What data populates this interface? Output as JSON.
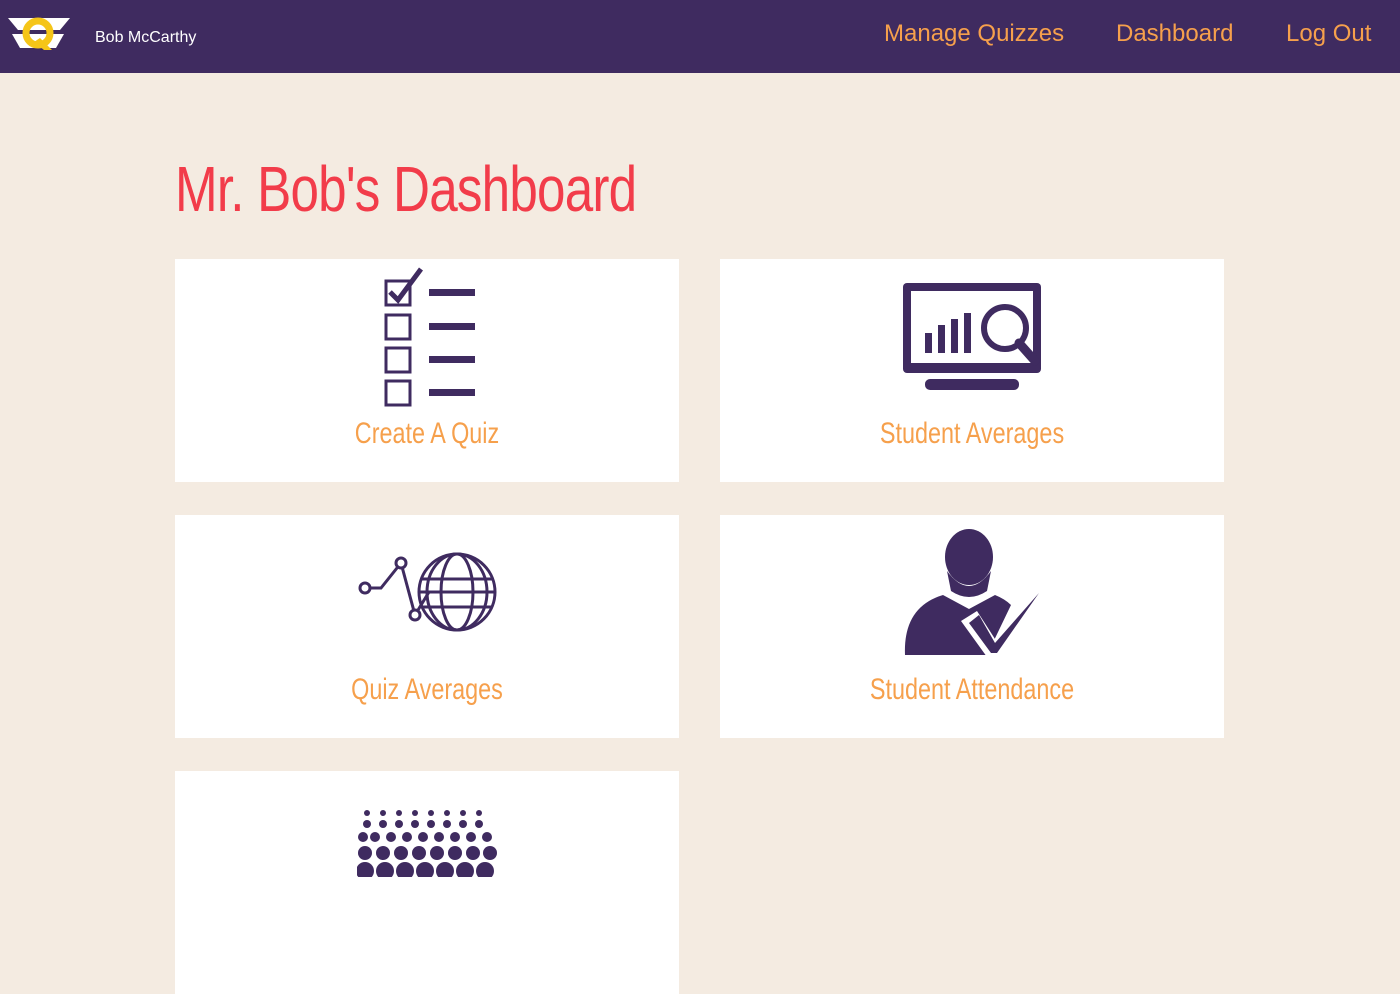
{
  "navbar": {
    "logo_icon": "quiz-logo-icon",
    "user_name": "Bob McCarthy",
    "links": [
      "Manage Quizzes",
      "Dashboard",
      "Log Out"
    ]
  },
  "main": {
    "title": "Mr. Bob's Dashboard",
    "cards": [
      {
        "label": "Create A Quiz",
        "icon": "checklist-icon"
      },
      {
        "label": "Student Averages",
        "icon": "monitor-analytics-icon"
      },
      {
        "label": "Quiz Averages",
        "icon": "globe-pulse-icon"
      },
      {
        "label": "Student Attendance",
        "icon": "student-check-icon"
      },
      {
        "label": "",
        "icon": "crowd-dots-icon"
      }
    ]
  },
  "colors": {
    "navbar_bg": "#3f2b60",
    "page_bg": "#f4ebe1",
    "accent_orange": "#f6a04c",
    "title_red": "#f23c4a",
    "icon_purple": "#3f2b60",
    "logo_yellow": "#f5c518"
  }
}
